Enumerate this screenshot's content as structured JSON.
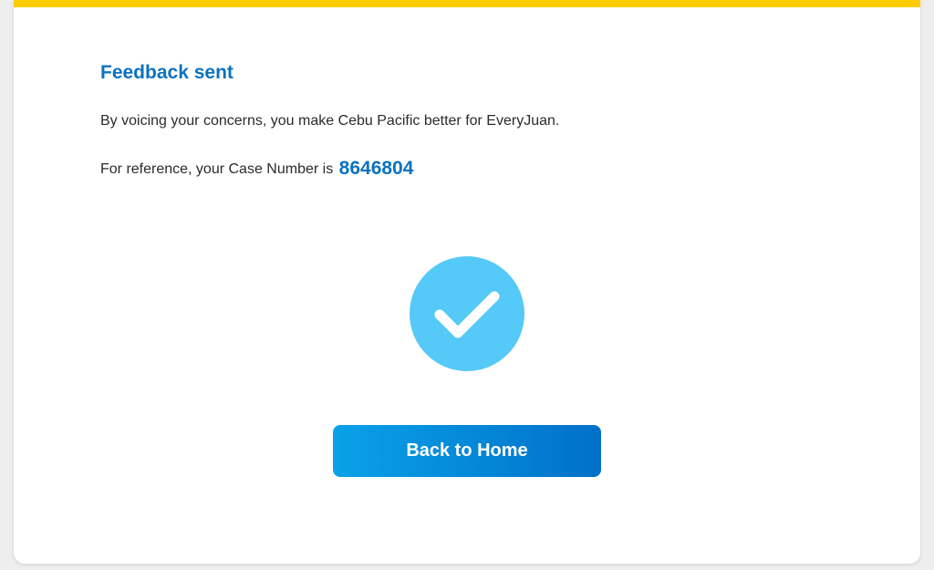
{
  "confirmation": {
    "title": "Feedback sent",
    "message": "By voicing your concerns, you make Cebu Pacific better for EveryJuan.",
    "reference_prefix": "For reference, your Case Number is",
    "case_number": "8646804",
    "success_icon": "check-icon",
    "back_button_label": "Back to Home"
  },
  "colors": {
    "accent_bar": "#ffcc00",
    "title_blue": "#0b72c0",
    "check_circle": "#55c9f7",
    "button_gradient_start": "#0aa2e8",
    "button_gradient_end": "#0070c9"
  }
}
